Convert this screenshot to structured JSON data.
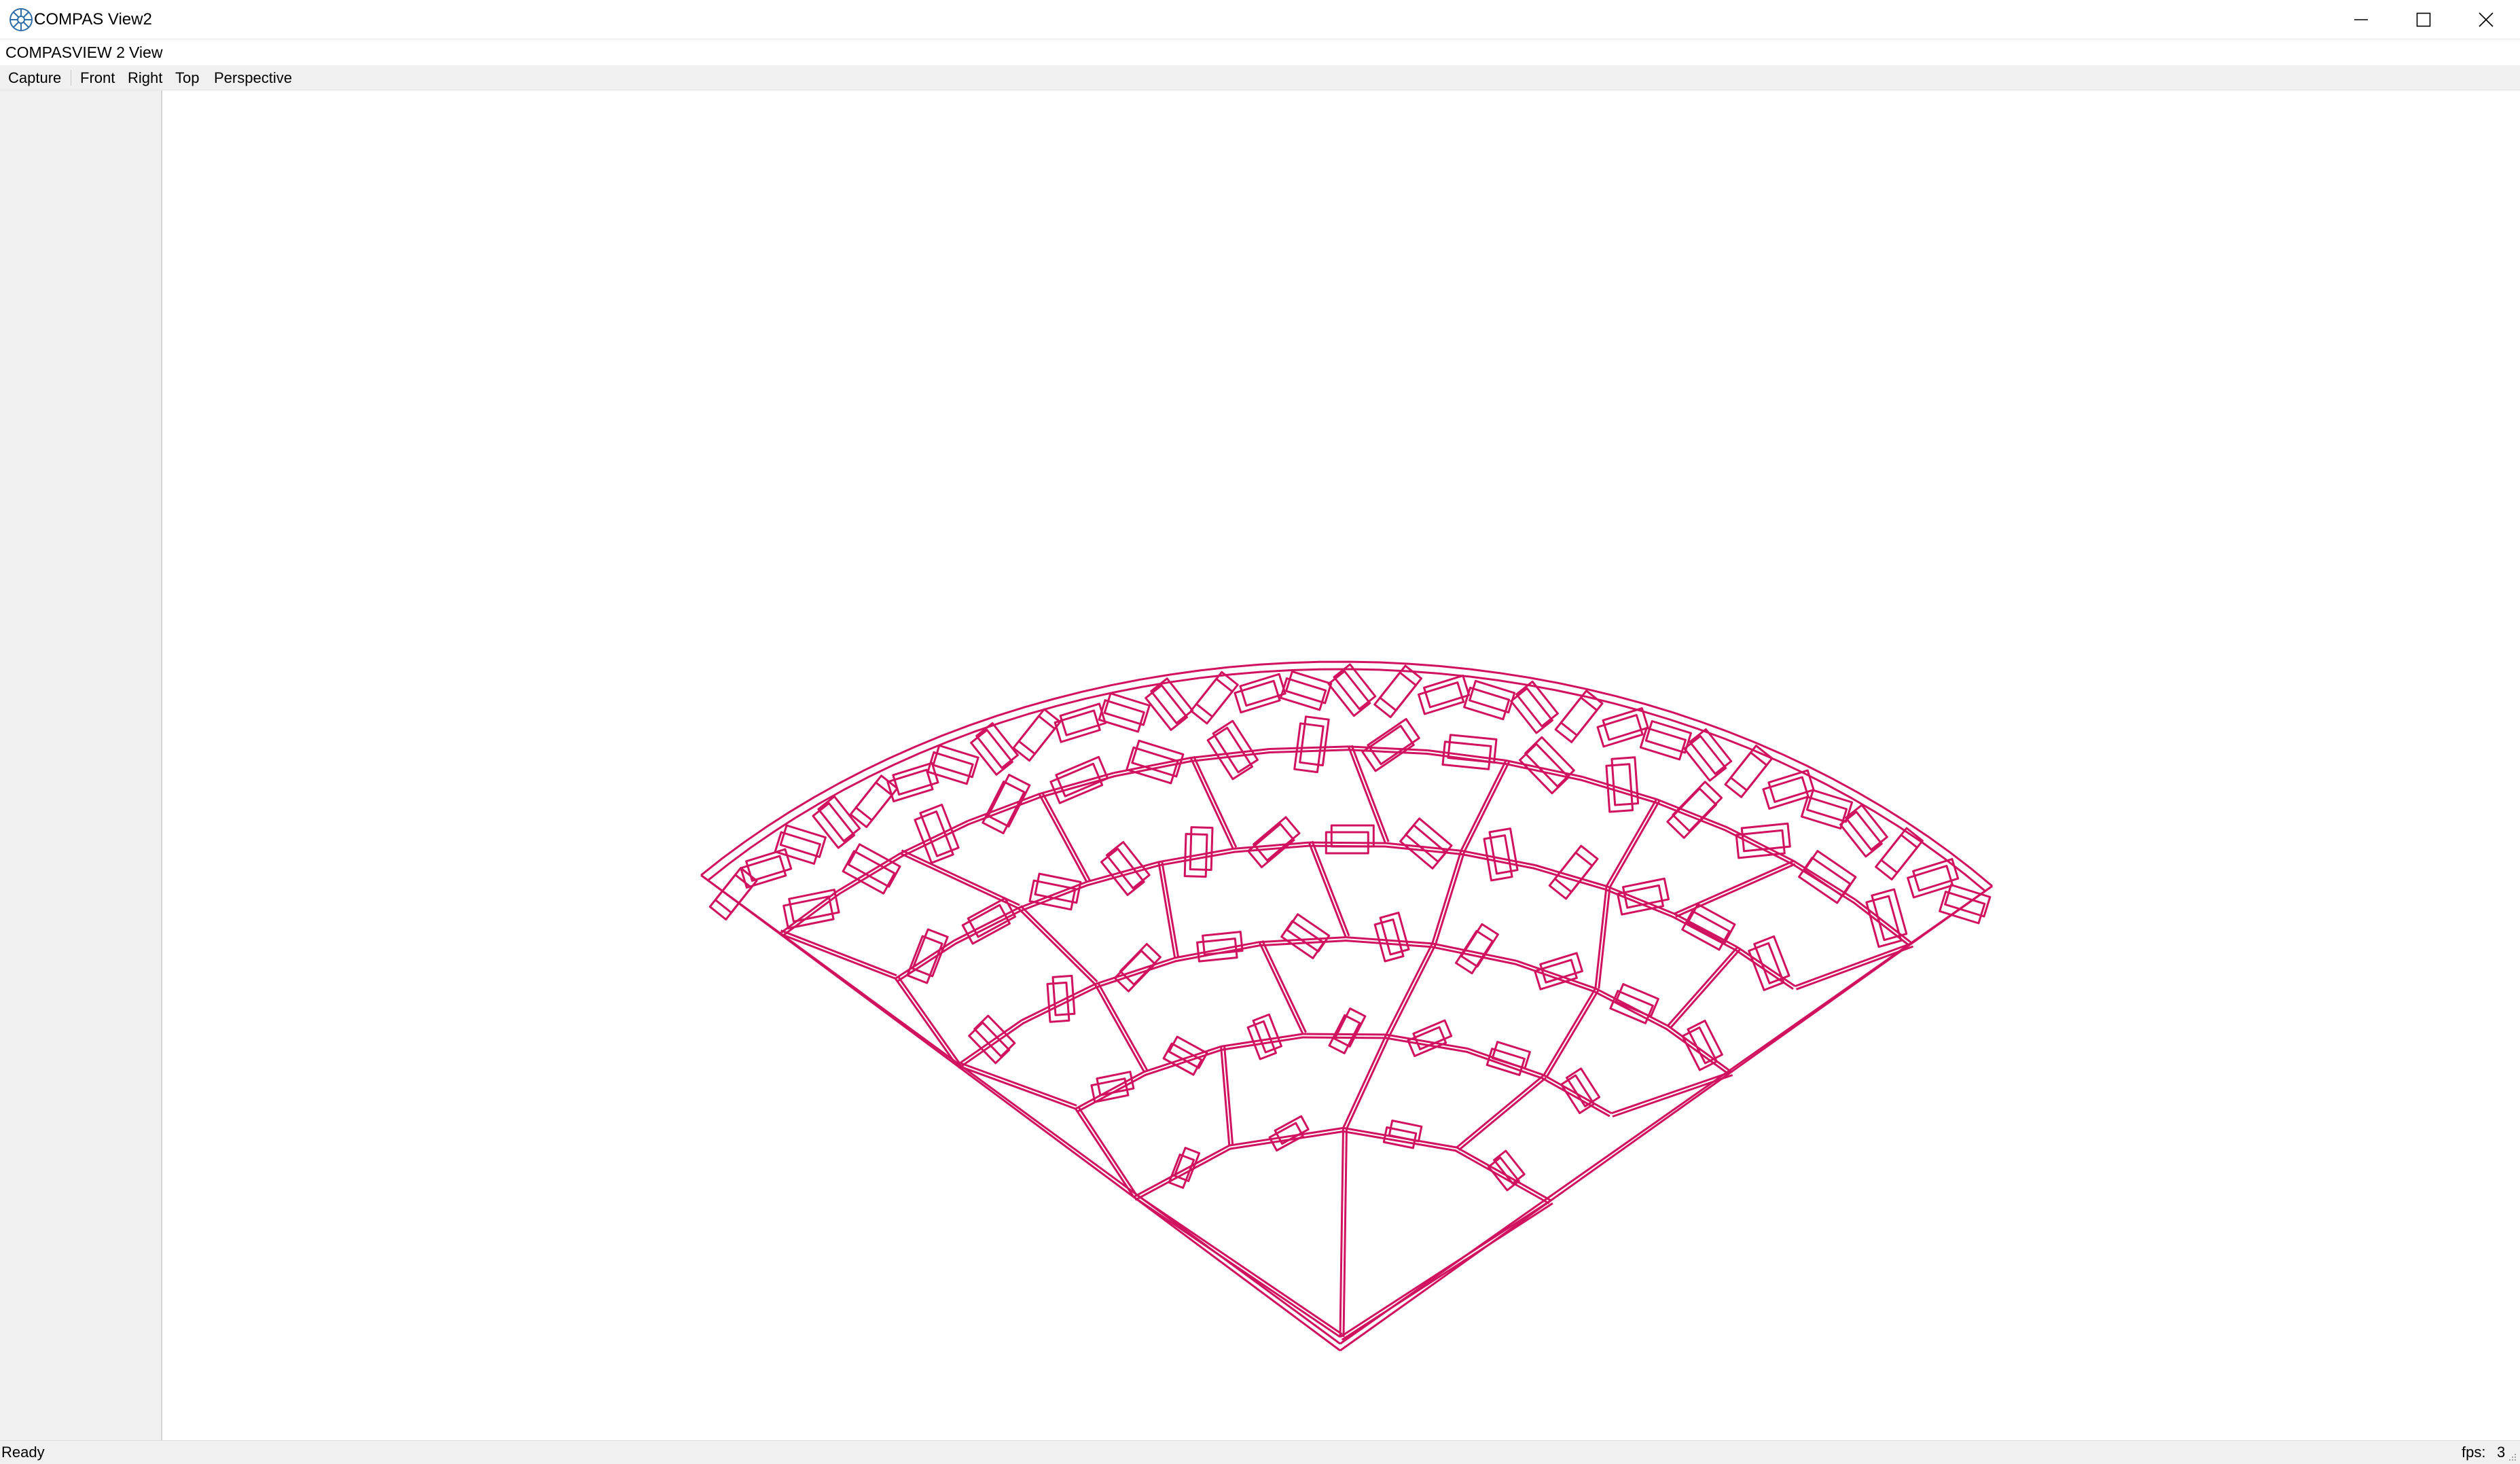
{
  "window": {
    "title": "COMPAS View2",
    "app_icon": "compas-logo-icon",
    "controls": [
      "minimize-icon",
      "maximize-icon",
      "close-icon"
    ]
  },
  "menubar": {
    "items": [
      {
        "label": "COMPASVIEW 2"
      },
      {
        "label": "View"
      }
    ]
  },
  "toolbar": {
    "capture": "Capture",
    "front": "Front",
    "right": "Right",
    "top": "Top",
    "perspective": "Perspective"
  },
  "viewport": {
    "model": "wireframe-shell-mesh",
    "line_color": "#d0125f",
    "background": "#ffffff"
  },
  "statusbar": {
    "status": "Ready",
    "fps_label": "fps:",
    "fps_value": "3"
  }
}
